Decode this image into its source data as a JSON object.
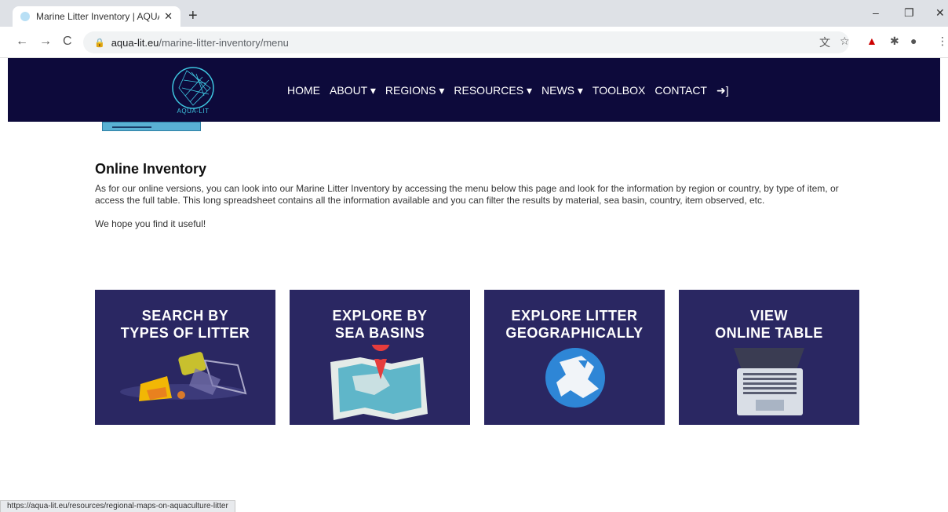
{
  "browser": {
    "tab_title": "Marine Litter Inventory | AQUA-LIT",
    "tab_close": "✕",
    "new_tab": "+",
    "url_domain": "aqua-lit.eu",
    "url_path": "/marine-litter-inventory/menu",
    "back": "←",
    "forward": "→",
    "reload": "C",
    "minimize": "–",
    "restore": "❐",
    "close": "✕",
    "lock": "🔒",
    "translate_icon": "文",
    "star_icon": "☆",
    "pdf_icon": "▲",
    "extensions_icon": "✱",
    "profile_icon": "●",
    "menu_icon": "⋮",
    "status_url": "https://aqua-lit.eu/resources/regional-maps-on-aquaculture-litter"
  },
  "site": {
    "logo_text": "AQUA-LIT",
    "menu": [
      {
        "label": "HOME"
      },
      {
        "label": "ABOUT ▾"
      },
      {
        "label": "REGIONS ▾"
      },
      {
        "label": "RESOURCES ▾"
      },
      {
        "label": "NEWS ▾"
      },
      {
        "label": "TOOLBOX"
      },
      {
        "label": "CONTACT"
      },
      {
        "label": "➜]"
      }
    ]
  },
  "main": {
    "heading": "Online Inventory",
    "paragraph": "As for our online versions, you can look into our Marine Litter Inventory by accessing the menu below this page and look for the information by region or country, by type of item, or access the full table. This long spreadsheet contains all the information available and you can filter the results by material, sea basin, country, item observed, etc.",
    "closing": "We hope you find it useful!",
    "cards": [
      {
        "line1": "SEARCH BY",
        "line2": "TYPES OF LITTER"
      },
      {
        "line1": "EXPLORE BY",
        "line2": "SEA BASINS"
      },
      {
        "line1": "EXPLORE LITTER",
        "line2": "GEOGRAPHICALLY"
      },
      {
        "line1": "VIEW",
        "line2": "ONLINE TABLE"
      }
    ]
  },
  "colors": {
    "nav_bg": "#0d0a3b",
    "card_bg": "#2a2762",
    "logo_accent": "#3ec6e0"
  }
}
